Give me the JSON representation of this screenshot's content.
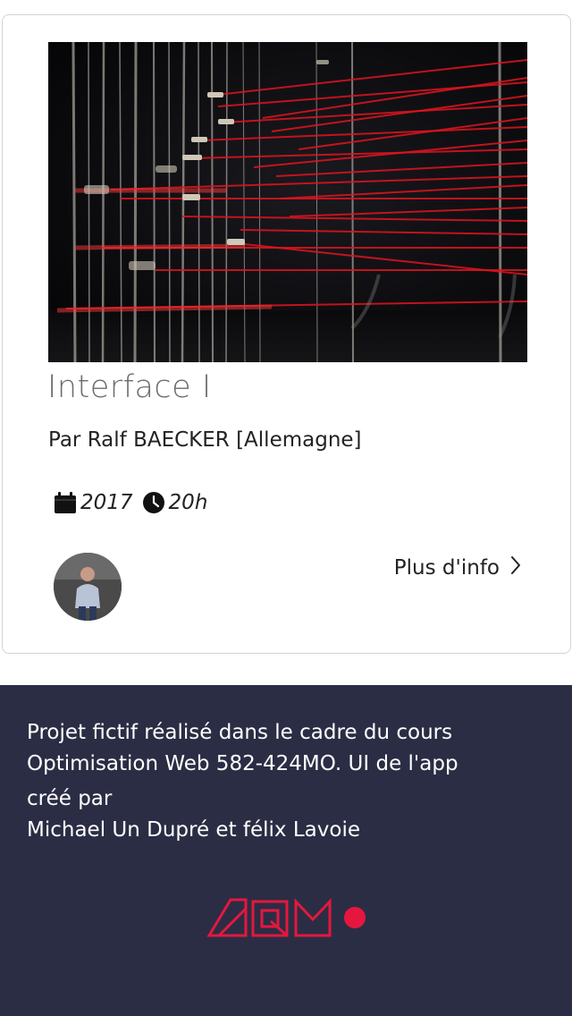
{
  "card": {
    "title": "Interface I",
    "artist": "Par Ralf BAECKER [Allemagne]",
    "year": "2017",
    "time": "20h",
    "more_label": "Plus d'info",
    "image_subject": "Installation of white vertical strings and red threads on black background"
  },
  "footer": {
    "line1": "Projet fictif réalisé dans le cadre du cours",
    "line2": "Optimisation Web 582-424MO. UI de l'app",
    "line3": "créé par",
    "line4": "Michael Un Dupré et félix Lavoie",
    "logo_letters": "AQM"
  },
  "colors": {
    "footer_bg": "#2b2d44",
    "accent_red": "#e5173f",
    "title_gray": "#6c6c6c"
  },
  "icons": {
    "calendar": "calendar-icon",
    "clock": "clock-icon",
    "chevron": "chevron-right-icon"
  }
}
